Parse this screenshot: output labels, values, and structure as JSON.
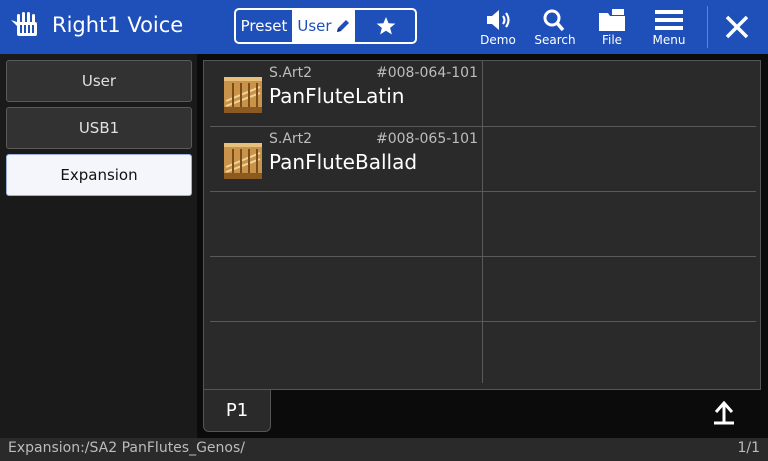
{
  "header": {
    "title": "Right1 Voice",
    "segments": {
      "preset": "Preset",
      "user": "User",
      "favorite_icon": "star-icon"
    },
    "tools": {
      "demo": "Demo",
      "search": "Search",
      "file": "File",
      "menu": "Menu"
    },
    "close_icon": "close-icon",
    "color": "#1f4fb8"
  },
  "sidebar": {
    "items": [
      {
        "label": "User",
        "active": false
      },
      {
        "label": "USB1",
        "active": false
      },
      {
        "label": "Expansion",
        "active": true
      }
    ]
  },
  "voices": [
    {
      "category": "S.Art2",
      "number": "#008-064-101",
      "name": "PanFluteLatin"
    },
    {
      "category": "S.Art2",
      "number": "#008-065-101",
      "name": "PanFluteBallad"
    }
  ],
  "page_tab": "P1",
  "status": {
    "path": "Expansion:/SA2 PanFlutes_Genos/",
    "page": "1/1"
  }
}
